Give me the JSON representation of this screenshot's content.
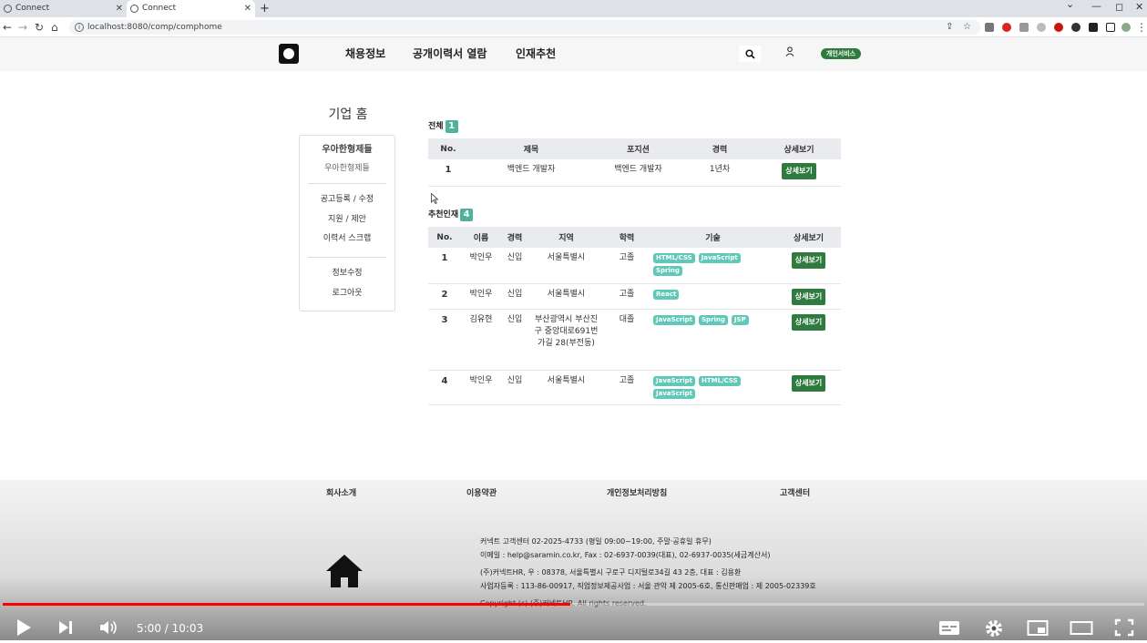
{
  "browser": {
    "tabs": [
      {
        "label": "Connect",
        "active": false
      },
      {
        "label": "Connect",
        "active": true
      }
    ],
    "new_tab": "+",
    "url": "localhost:8080/comp/comphome"
  },
  "site_header": {
    "nav": [
      "채용정보",
      "공개이력서 열람",
      "인재추천"
    ],
    "service_badge": "개인서비스"
  },
  "page_title": "기업 홈",
  "sidebar": {
    "company_name": "우아한형제들",
    "company_name_sub": "우아한형제들",
    "menu1": [
      "공고등록 / 수정",
      "지원 / 제안",
      "이력서 스크랩"
    ],
    "menu2": [
      "정보수정",
      "로그아웃"
    ]
  },
  "jobs": {
    "section_label": "전체",
    "count": "1",
    "headers": [
      "No.",
      "제목",
      "포지션",
      "경력",
      "상세보기"
    ],
    "rows": [
      {
        "no": "1",
        "title": "백엔드 개발자",
        "position": "백엔드 개발자",
        "career": "1년차",
        "button": "상세보기"
      }
    ]
  },
  "recommend": {
    "section_label": "추천인재",
    "count": "4",
    "headers": [
      "No.",
      "이름",
      "경력",
      "지역",
      "학력",
      "기술",
      "상세보기"
    ],
    "rows": [
      {
        "no": "1",
        "name": "박인우",
        "career": "신입",
        "region": "서울특별시",
        "edu": "고졸",
        "skills": [
          "HTML/CSS",
          "JavaScript",
          "Spring"
        ],
        "button": "상세보기"
      },
      {
        "no": "2",
        "name": "박인우",
        "career": "신입",
        "region": "서울특별시",
        "edu": "고졸",
        "skills": [
          "React"
        ],
        "button": "상세보기"
      },
      {
        "no": "3",
        "name": "김유현",
        "career": "신입",
        "region": "부산광역시 부산진구 중앙대로691번가길 28(부전동)",
        "edu": "대졸",
        "skills": [
          "JavaScript",
          "Spring",
          "JSP"
        ],
        "button": "상세보기"
      },
      {
        "no": "4",
        "name": "박인우",
        "career": "신입",
        "region": "서울특별시",
        "edu": "고졸",
        "skills": [
          "JavaScript",
          "HTML/CSS",
          "JavaScript"
        ],
        "button": "상세보기"
      }
    ]
  },
  "footer": {
    "links": [
      "회사소개",
      "이용약관",
      "개인정보처리방침",
      "고객센터"
    ],
    "info": [
      "커넥트 고객센터 02-2025-4733 (평일 09:00~19:00, 주말·공휴일 휴무)",
      "이메일 : help@saramin.co.kr, Fax : 02-6937-0039(대표), 02-6937-0035(세금계산서)",
      "(주)커넥트HR, 우 : 08378, 서울특별시 구로구 디지털로34길 43 2층, 대표 : 김용환",
      "사업자등록 : 113-86-00917, 직업정보제공사업 : 서울 관악 제 2005-6호, 통신판매업 : 제 2005-02339호",
      "Copyright (c) (주)커넥트HR. All rights reserved."
    ]
  },
  "player": {
    "time": "5:00 / 10:03",
    "progress": 0.497
  },
  "colors": {
    "accent_green": "#2f7a3e",
    "count_teal": "#4fb29a",
    "skill_teal": "#5fc8b8",
    "progress_red": "#ff0000"
  }
}
